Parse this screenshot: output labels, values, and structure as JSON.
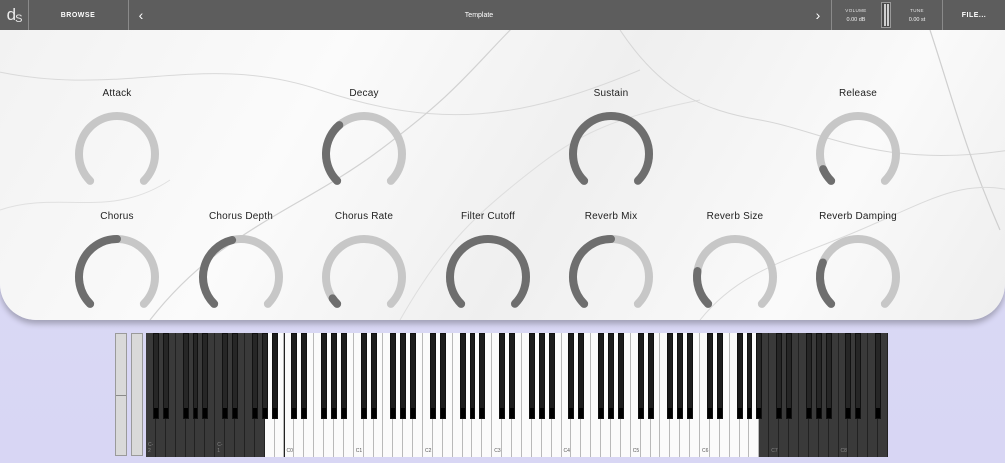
{
  "app": {
    "logo_main": "d",
    "logo_sub": "S"
  },
  "toolbar": {
    "browse_label": "BROWSE",
    "prev_glyph": "‹",
    "next_glyph": "›",
    "preset_name": "Template",
    "volume_label": "VOLUME",
    "volume_value": "0.00 dB",
    "tune_label": "TUNE",
    "tune_value": "0.00 st",
    "file_label": "FILE..."
  },
  "colors": {
    "topbar": "#5d5d5d",
    "knob_track": "#c7c7c7",
    "knob_value": "#6e6e6e",
    "background": "#dcdcf6"
  },
  "knobs": [
    {
      "id": "attack",
      "label": "Attack",
      "value": 0.0
    },
    {
      "id": "decay",
      "label": "Decay",
      "value": 0.35
    },
    {
      "id": "sustain",
      "label": "Sustain",
      "value": 1.0
    },
    {
      "id": "release",
      "label": "Release",
      "value": 0.08
    },
    {
      "id": "chorus",
      "label": "Chorus",
      "value": 0.5
    },
    {
      "id": "chorus-depth",
      "label": "Chorus Depth",
      "value": 0.45
    },
    {
      "id": "chorus-rate",
      "label": "Chorus Rate",
      "value": 0.04
    },
    {
      "id": "filter-cutoff",
      "label": "Filter Cutoff",
      "value": 1.0
    },
    {
      "id": "reverb-mix",
      "label": "Reverb Mix",
      "value": 0.5
    },
    {
      "id": "reverb-size",
      "label": "Reverb Size",
      "value": 0.2
    },
    {
      "id": "reverb-damping",
      "label": "Reverb Damping",
      "value": 0.25
    }
  ],
  "keyboard": {
    "octave_labels": [
      "C-2",
      "C-1",
      "C0",
      "C1",
      "C2",
      "C3",
      "C4",
      "C5",
      "C6",
      "C7",
      "C8"
    ]
  }
}
